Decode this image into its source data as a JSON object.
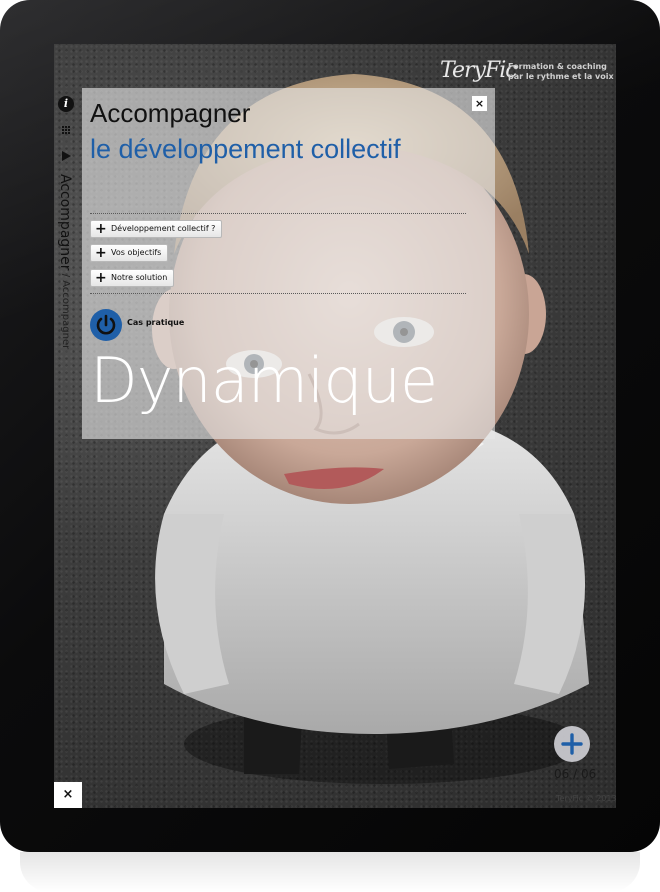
{
  "logo": {
    "brand": "TeryFic",
    "tagline_line1": "Formation & coaching",
    "tagline_line2": "par le rythme et la voix"
  },
  "sidebar": {
    "section_label": "Accompagner",
    "sub_label": " / Accompagner"
  },
  "panel": {
    "close_label": "×",
    "title": "Accompagner",
    "subtitle": "le développement collectif",
    "buttons": [
      {
        "label": "Développement collectif ?"
      },
      {
        "label": "Vos objectifs"
      },
      {
        "label": "Notre solution"
      }
    ],
    "case_label": "Cas pratique",
    "big_word": "Dynamique"
  },
  "footer": {
    "page_counter": "06 / 06",
    "copyright": "TeryFic © 2013",
    "close_label": "×"
  },
  "colors": {
    "accent_blue": "#1f5fa8",
    "panel_bg": "rgba(230,230,230,0.62)"
  },
  "icons": {
    "info": "info-icon",
    "grid": "grid-icon",
    "play": "play-icon",
    "power": "power-icon",
    "plus": "plus-icon",
    "close": "close-icon"
  }
}
